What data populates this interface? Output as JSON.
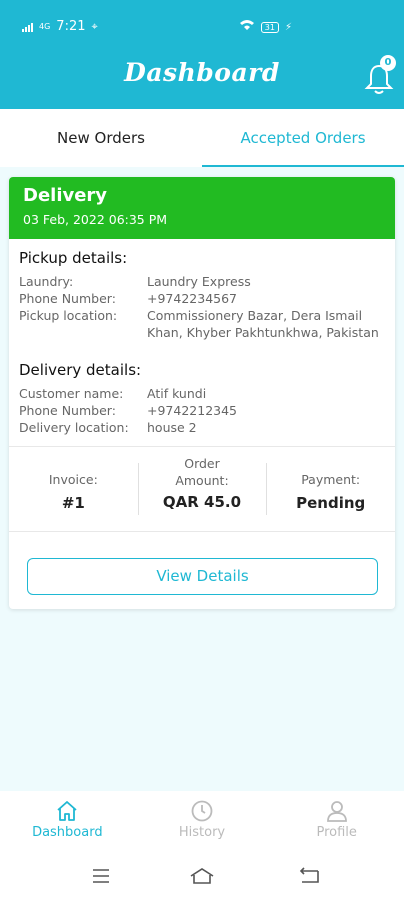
{
  "status_bar": {
    "time": "7:21",
    "network": "4G",
    "battery": "31"
  },
  "header": {
    "title": "Dashboard",
    "notification_count": "0"
  },
  "tabs": [
    {
      "label": "New Orders",
      "active": false
    },
    {
      "label": "Accepted Orders",
      "active": true
    }
  ],
  "order": {
    "type": "Delivery",
    "datetime": "03 Feb, 2022 06:35 PM",
    "pickup": {
      "heading": "Pickup details:",
      "rows": [
        {
          "label": "Laundry:",
          "value": "Laundry Express"
        },
        {
          "label": "Phone Number:",
          "value": "+9742234567"
        },
        {
          "label": "Pickup location:",
          "value": "Commissionery Bazar, Dera Ismail Khan, Khyber Pakhtunkhwa, Pakistan"
        }
      ]
    },
    "delivery": {
      "heading": "Delivery details:",
      "rows": [
        {
          "label": "Customer name:",
          "value": "Atif kundi"
        },
        {
          "label": "Phone Number:",
          "value": "+9742212345"
        },
        {
          "label": "Delivery location:",
          "value": "house 2"
        }
      ]
    },
    "stats": {
      "invoice_label": "Invoice:",
      "invoice_value": "#1",
      "amount_label": "Order Amount:",
      "amount_value": "QAR 45.0",
      "payment_label": "Payment:",
      "payment_value": "Pending"
    },
    "view_details_label": "View Details"
  },
  "bottom_nav": [
    {
      "label": "Dashboard",
      "icon": "home-icon",
      "active": true
    },
    {
      "label": "History",
      "icon": "clock-icon",
      "active": false
    },
    {
      "label": "Profile",
      "icon": "user-icon",
      "active": false
    }
  ],
  "colors": {
    "primary": "#1fb8d3",
    "delivery_green": "#22bb22",
    "background": "#eefbfd"
  }
}
